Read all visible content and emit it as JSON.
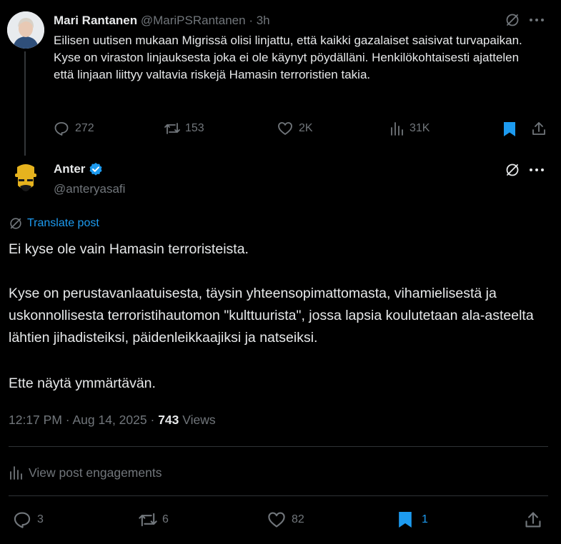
{
  "parent": {
    "name": "Mari Rantanen",
    "handle": "@MariPSRantanen",
    "time": "· 3h",
    "text": "Eilisen uutisen mukaan Migrissä olisi linjattu, että kaikki gazalaiset saisivat turvapaikan. Kyse on viraston linjauksesta joka ei ole käynyt pöydälläni. Henkilökohtaisesti ajattelen että linjaan liittyy valtavia riskejä Hamasin terroristien takia.",
    "replies": "272",
    "reposts": "153",
    "likes": "2K",
    "views": "31K"
  },
  "post": {
    "name": "Anter",
    "handle": "@anteryasafi",
    "translate": "Translate post",
    "line1": "Ei kyse ole vain Hamasin terroristeista.",
    "line2": "Kyse on perustavanlaatuisesta, täysin yhteensopimattomasta, vihamielisestä ja uskonnollisesta terroristihautomon \"kulttuurista\", jossa lapsia koulutetaan ala-asteelta lähtien jihadisteiksi, päidenleikkaajiksi ja natseiksi.",
    "line3": "Ette näytä ymmärtävän.",
    "timestamp": "12:17 PM · Aug 14, 2025 ·",
    "views_count": "743",
    "views_label": "Views",
    "engagements": "View post engagements",
    "replies": "3",
    "reposts": "6",
    "likes": "82",
    "bookmarks": "1"
  },
  "colors": {
    "accent": "#1d9bf0",
    "verified": "#1d9bf0",
    "muted": "#71767b",
    "divider": "#2f3336"
  }
}
